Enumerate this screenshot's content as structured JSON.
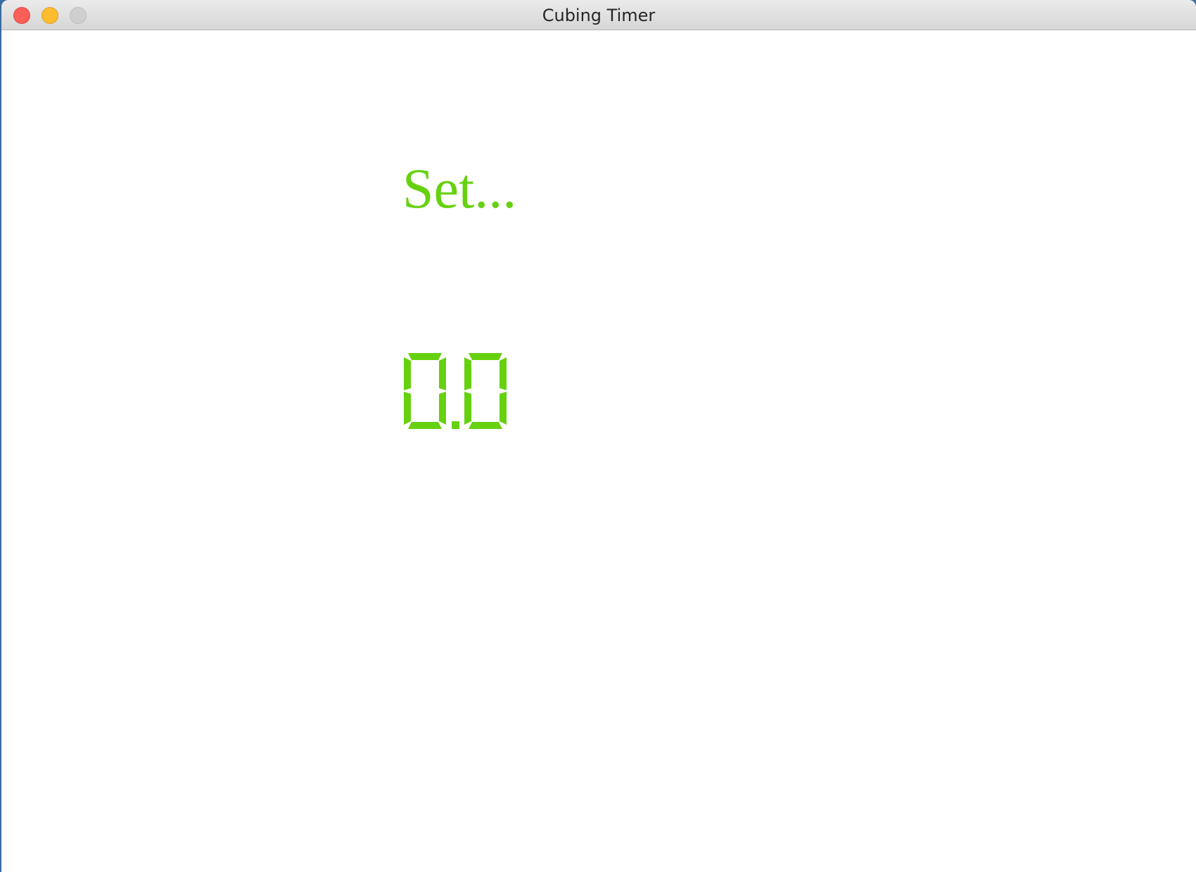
{
  "window": {
    "title": "Cubing Timer"
  },
  "status": {
    "label": "Set..."
  },
  "timer": {
    "value": "0.0",
    "color": "#66d10f"
  },
  "colors": {
    "accent": "#66d10f",
    "close": "#fc5f57",
    "minimize": "#fdbc2e",
    "zoom_disabled": "#cfcfcf"
  }
}
